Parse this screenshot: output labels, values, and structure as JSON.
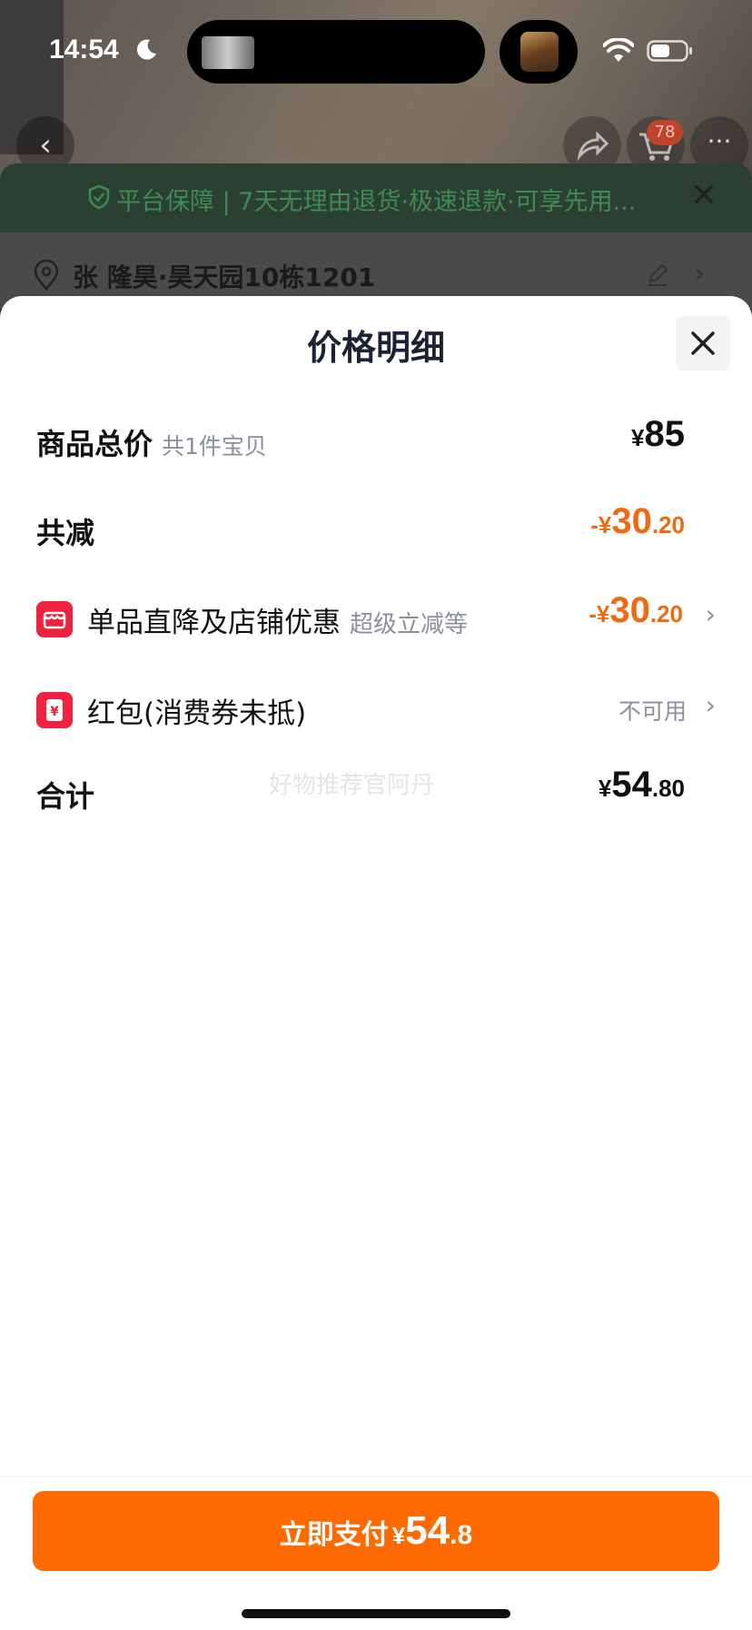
{
  "status_bar": {
    "time": "14:54"
  },
  "nav": {
    "cart_count": "78",
    "back_glyph": "‹",
    "more_glyph": "···"
  },
  "guarantee": {
    "text": "平台保障 | 7天无理由退货·极速退款·可享先用...",
    "close_glyph": "✕"
  },
  "address": {
    "text": "张 隆昊·昊天园10栋1201",
    "chevron": "›"
  },
  "sheet": {
    "title": "价格明细",
    "rows": {
      "total": {
        "label": "商品总价",
        "sub": "共1件宝贝",
        "yen": "¥",
        "int": "85",
        "dec": ""
      },
      "discount": {
        "label": "共减",
        "yen": "-¥",
        "int": "30",
        "dec": ".20"
      },
      "store_discount": {
        "label": "单品直降及店铺优惠",
        "sub": "超级立减等",
        "yen": "-¥",
        "int": "30",
        "dec": ".20",
        "chevron": "›"
      },
      "red_packet": {
        "label": "红包(消费券未抵)",
        "value": "不可用",
        "chevron": "›"
      },
      "sum": {
        "label": "合计",
        "yen": "¥",
        "int": "54",
        "dec": ".80"
      }
    },
    "watermark": "好物推荐官阿丹"
  },
  "pay_button": {
    "label": "立即支付",
    "yen": "¥",
    "int": "54",
    "dec": ".8"
  },
  "colors": {
    "accent": "#ff6a00",
    "discount": "#f06a14",
    "icon_red": "#f0223f",
    "guarantee_green": "#3f8a55"
  },
  "icons": [
    "moon-icon",
    "wifi-icon",
    "battery-icon",
    "back-icon",
    "share-icon",
    "cart-icon",
    "more-icon",
    "shield-icon",
    "location-pin-icon",
    "edit-icon",
    "close-icon",
    "store-icon",
    "red-packet-icon"
  ]
}
